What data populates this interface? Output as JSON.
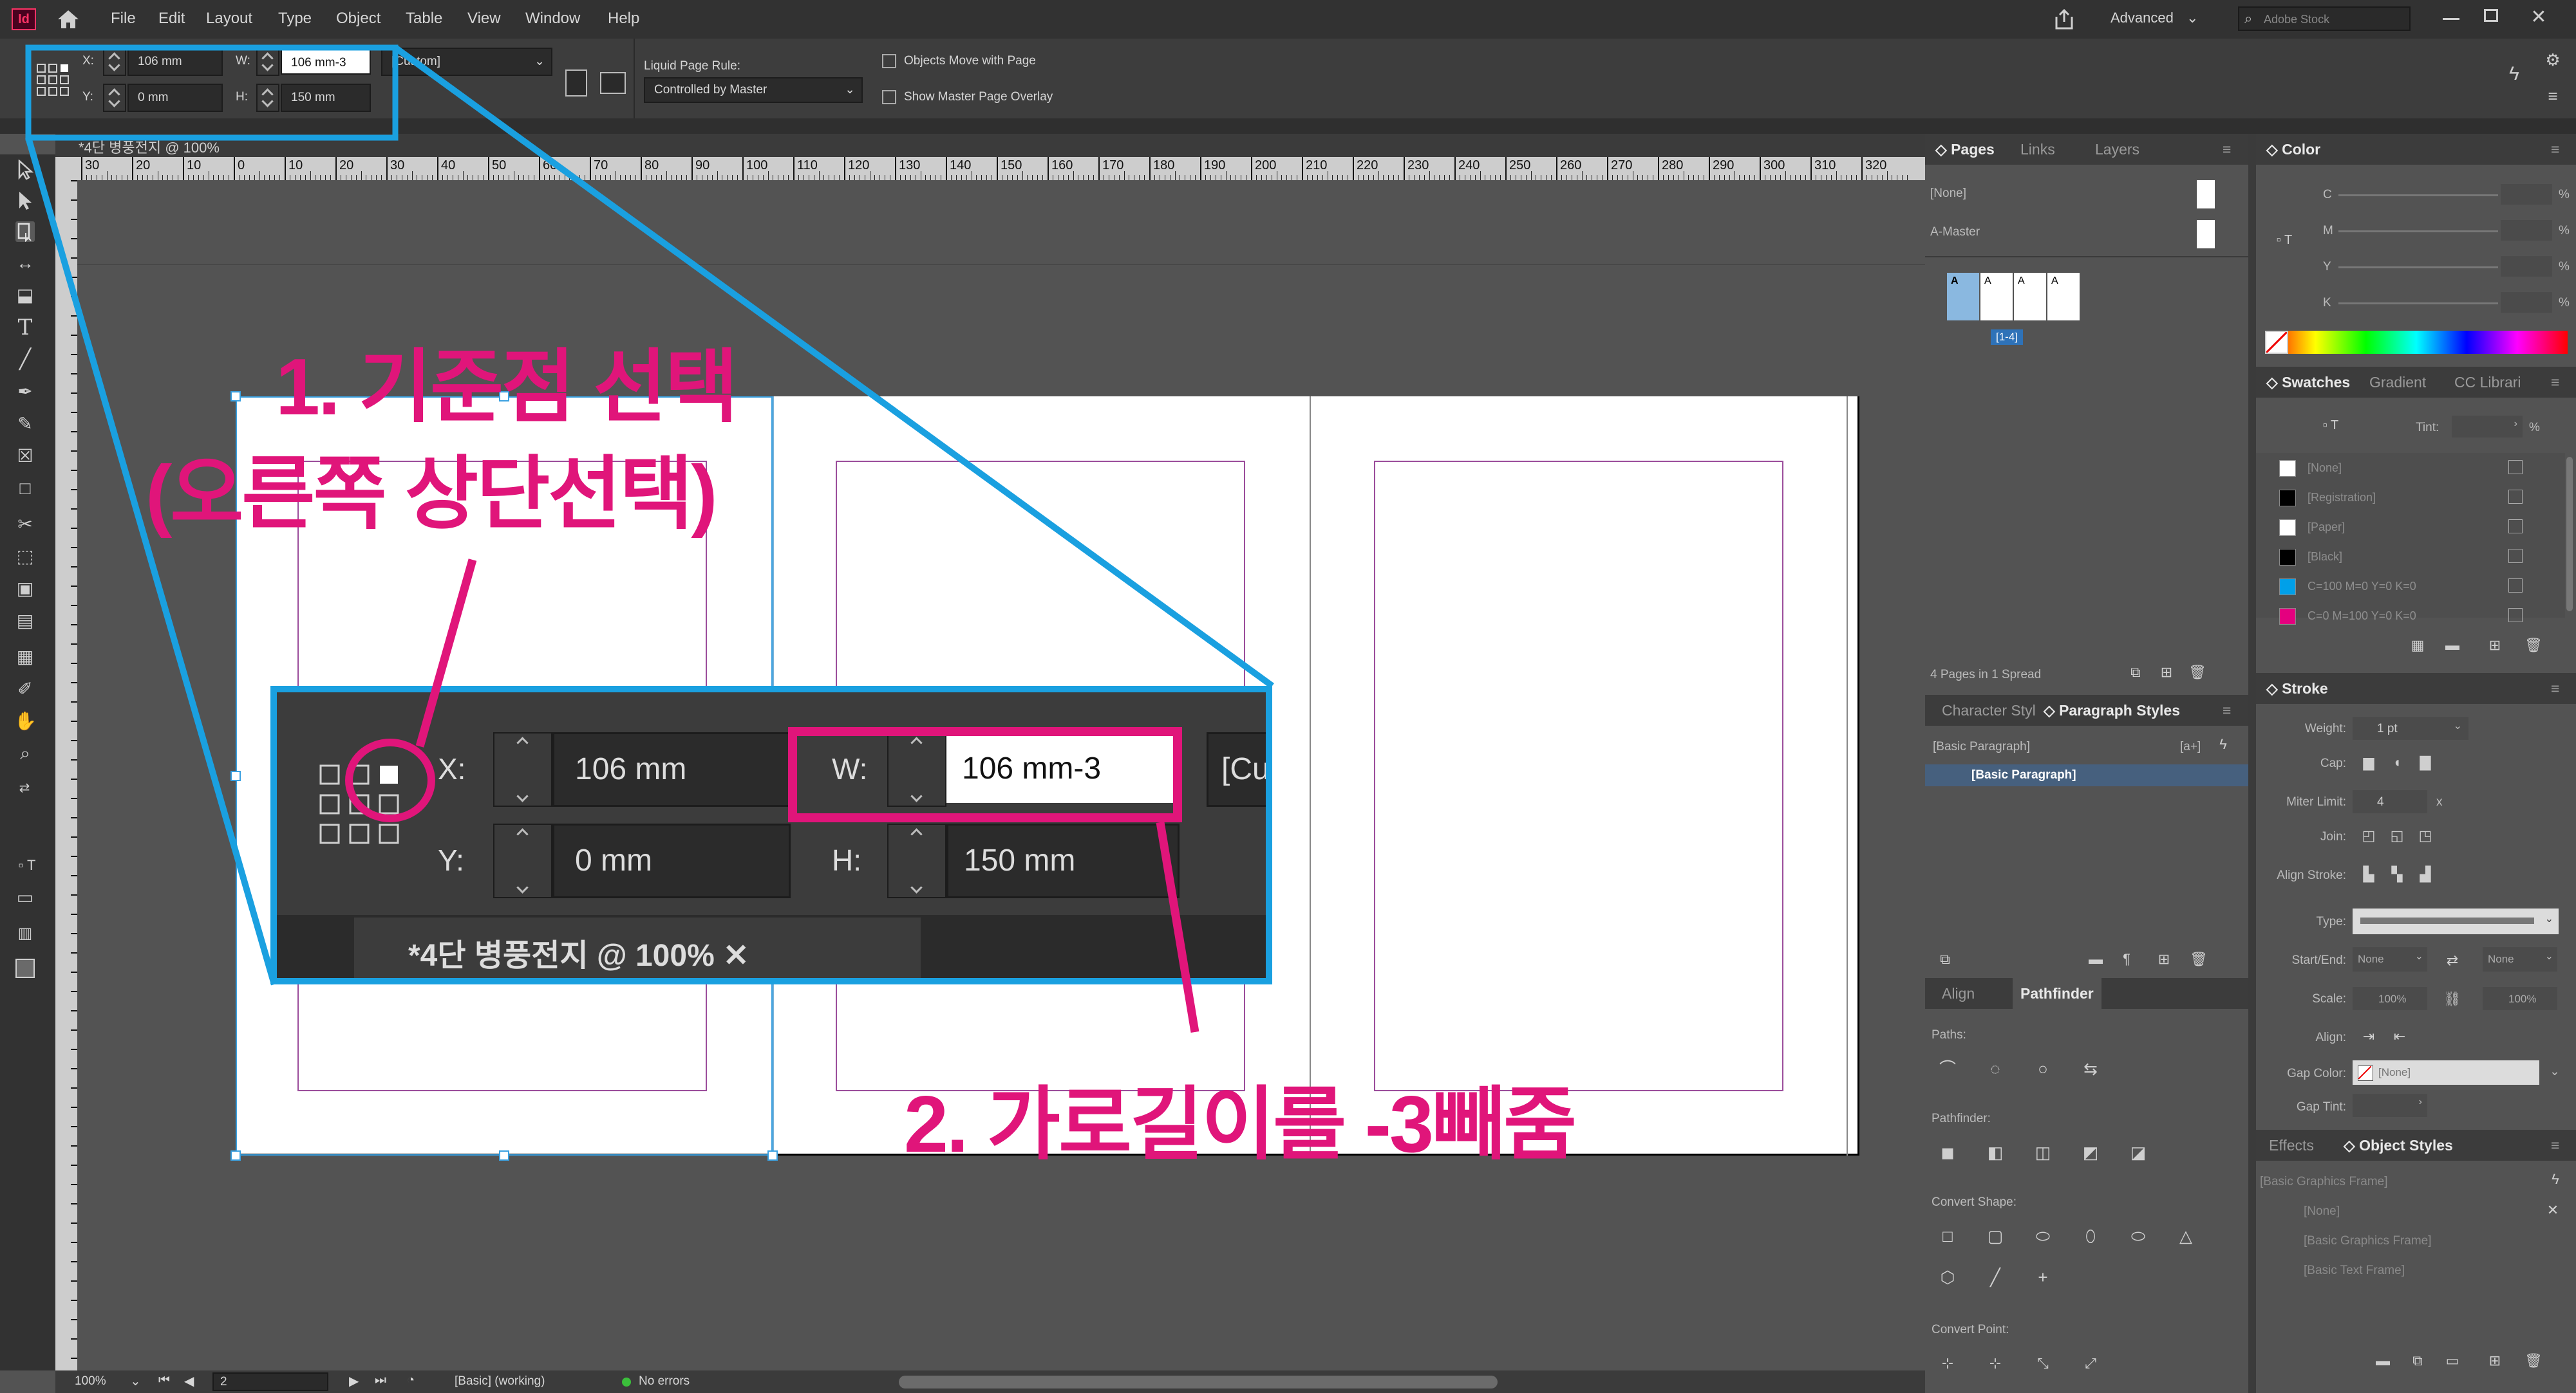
{
  "app": {
    "logo": "Id",
    "workspace": "Advanced",
    "stock_placeholder": "Adobe Stock"
  },
  "menu": [
    "File",
    "Edit",
    "Layout",
    "Type",
    "Object",
    "Table",
    "View",
    "Window",
    "Help"
  ],
  "control_panel": {
    "x_label": "X:",
    "x_value": "106 mm",
    "y_label": "Y:",
    "y_value": "0 mm",
    "w_label": "W:",
    "w_value": "106 mm-3",
    "h_label": "H:",
    "h_value": "150 mm",
    "size_preset": "[Custom]",
    "liquid_rule_label": "Liquid Page Rule:",
    "liquid_rule_value": "Controlled by Master",
    "objects_move": "Objects Move with Page",
    "show_overlay": "Show Master Page Overlay"
  },
  "document_tab": {
    "title": "*4단 병풍전지 @ 100%",
    "close": "✕"
  },
  "ruler_labels": [
    "30",
    "20",
    "10",
    "0",
    "10",
    "20",
    "30",
    "40",
    "50",
    "60",
    "70",
    "80",
    "90",
    "100",
    "110",
    "120",
    "130",
    "140",
    "150",
    "160",
    "170",
    "180",
    "190",
    "200",
    "210",
    "220",
    "230",
    "240",
    "250",
    "260",
    "270",
    "280",
    "290",
    "300",
    "310",
    "320"
  ],
  "annotations": {
    "step1_line1": "1. 기준점 선택",
    "step1_line2": "(오른쪽 상단선택)",
    "step2": "2. 가로길이를 -3빼줌"
  },
  "zoom_callout": {
    "x_label": "X:",
    "x_value": "106 mm",
    "y_label": "Y:",
    "y_value": "0 mm",
    "w_label": "W:",
    "w_value": "106 mm-3",
    "h_label": "H:",
    "h_value": "150 mm",
    "cut": "[Cu",
    "tab": "*4단 병풍전지 @ 100%  ✕"
  },
  "pages_panel": {
    "tabs": [
      "Pages",
      "Links",
      "Layers"
    ],
    "none_master": "[None]",
    "a_master": "A-Master",
    "page_letter": "A",
    "range": "[1-4]",
    "footer": "4 Pages in 1 Spread"
  },
  "styles_panel": {
    "tabs": [
      "Character Styl",
      "Paragraph Styles"
    ],
    "item1": "[Basic Paragraph]",
    "item1_badge": "[a+]",
    "item2": "[Basic Paragraph]"
  },
  "pathfinder_panel": {
    "tabs": [
      "Align",
      "Pathfinder"
    ],
    "paths": "Paths:",
    "pathfinder": "Pathfinder:",
    "convert_shape": "Convert Shape:",
    "convert_point": "Convert Point:"
  },
  "color_panel": {
    "tab": "Color",
    "channels": [
      "C",
      "M",
      "Y",
      "K"
    ],
    "unit": "%",
    "stroke_initial": "T"
  },
  "swatches_panel": {
    "tabs": [
      "Swatches",
      "Gradient",
      "CC Librari"
    ],
    "tint_label": "Tint:",
    "tint_unit": "%",
    "fill_initial": "T",
    "items": [
      {
        "name": "[None]",
        "color": "#ffffff"
      },
      {
        "name": "[Registration]",
        "color": "#000000"
      },
      {
        "name": "[Paper]",
        "color": "#ffffff"
      },
      {
        "name": "[Black]",
        "color": "#000000"
      },
      {
        "name": "C=100 M=0 Y=0 K=0",
        "color": "#00a0e9"
      },
      {
        "name": "C=0 M=100 Y=0 K=0",
        "color": "#e4007f"
      }
    ]
  },
  "stroke_panel": {
    "tab": "Stroke",
    "weight_label": "Weight:",
    "weight_value": "1 pt",
    "cap_label": "Cap:",
    "miter_label": "Miter Limit:",
    "miter_value": "4",
    "miter_unit": "x",
    "join_label": "Join:",
    "align_label": "Align Stroke:",
    "type_label": "Type:",
    "start_end_label": "Start/End:",
    "start_value": "None",
    "end_value": "None",
    "scale_label": "Scale:",
    "scale_start": "100%",
    "scale_end": "100%",
    "align2_label": "Align:",
    "gap_color_label": "Gap Color:",
    "gap_color_value": "[None]",
    "gap_tint_label": "Gap Tint:"
  },
  "object_styles_panel": {
    "tabs": [
      "Effects",
      "Object Styles"
    ],
    "items": [
      "[Basic Graphics Frame]",
      "[None]",
      "[Basic Graphics Frame]",
      "[Basic Text Frame]"
    ]
  },
  "status_bar": {
    "zoom": "100%",
    "page": "2",
    "style": "[Basic] (working)",
    "errors": "No errors"
  },
  "colors": {
    "accent_blue": "#1aa0e0",
    "accent_pink": "#e0157a",
    "menubar": "#323232",
    "panel": "#535353"
  }
}
